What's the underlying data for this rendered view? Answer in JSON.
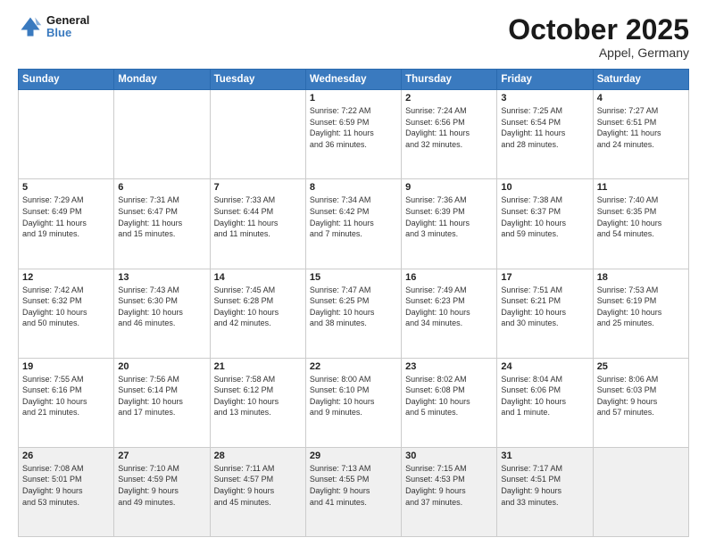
{
  "header": {
    "logo_line1": "General",
    "logo_line2": "Blue",
    "title": "October 2025",
    "subtitle": "Appel, Germany"
  },
  "weekdays": [
    "Sunday",
    "Monday",
    "Tuesday",
    "Wednesday",
    "Thursday",
    "Friday",
    "Saturday"
  ],
  "weeks": [
    [
      {
        "day": "",
        "info": ""
      },
      {
        "day": "",
        "info": ""
      },
      {
        "day": "",
        "info": ""
      },
      {
        "day": "1",
        "info": "Sunrise: 7:22 AM\nSunset: 6:59 PM\nDaylight: 11 hours\nand 36 minutes."
      },
      {
        "day": "2",
        "info": "Sunrise: 7:24 AM\nSunset: 6:56 PM\nDaylight: 11 hours\nand 32 minutes."
      },
      {
        "day": "3",
        "info": "Sunrise: 7:25 AM\nSunset: 6:54 PM\nDaylight: 11 hours\nand 28 minutes."
      },
      {
        "day": "4",
        "info": "Sunrise: 7:27 AM\nSunset: 6:51 PM\nDaylight: 11 hours\nand 24 minutes."
      }
    ],
    [
      {
        "day": "5",
        "info": "Sunrise: 7:29 AM\nSunset: 6:49 PM\nDaylight: 11 hours\nand 19 minutes."
      },
      {
        "day": "6",
        "info": "Sunrise: 7:31 AM\nSunset: 6:47 PM\nDaylight: 11 hours\nand 15 minutes."
      },
      {
        "day": "7",
        "info": "Sunrise: 7:33 AM\nSunset: 6:44 PM\nDaylight: 11 hours\nand 11 minutes."
      },
      {
        "day": "8",
        "info": "Sunrise: 7:34 AM\nSunset: 6:42 PM\nDaylight: 11 hours\nand 7 minutes."
      },
      {
        "day": "9",
        "info": "Sunrise: 7:36 AM\nSunset: 6:39 PM\nDaylight: 11 hours\nand 3 minutes."
      },
      {
        "day": "10",
        "info": "Sunrise: 7:38 AM\nSunset: 6:37 PM\nDaylight: 10 hours\nand 59 minutes."
      },
      {
        "day": "11",
        "info": "Sunrise: 7:40 AM\nSunset: 6:35 PM\nDaylight: 10 hours\nand 54 minutes."
      }
    ],
    [
      {
        "day": "12",
        "info": "Sunrise: 7:42 AM\nSunset: 6:32 PM\nDaylight: 10 hours\nand 50 minutes."
      },
      {
        "day": "13",
        "info": "Sunrise: 7:43 AM\nSunset: 6:30 PM\nDaylight: 10 hours\nand 46 minutes."
      },
      {
        "day": "14",
        "info": "Sunrise: 7:45 AM\nSunset: 6:28 PM\nDaylight: 10 hours\nand 42 minutes."
      },
      {
        "day": "15",
        "info": "Sunrise: 7:47 AM\nSunset: 6:25 PM\nDaylight: 10 hours\nand 38 minutes."
      },
      {
        "day": "16",
        "info": "Sunrise: 7:49 AM\nSunset: 6:23 PM\nDaylight: 10 hours\nand 34 minutes."
      },
      {
        "day": "17",
        "info": "Sunrise: 7:51 AM\nSunset: 6:21 PM\nDaylight: 10 hours\nand 30 minutes."
      },
      {
        "day": "18",
        "info": "Sunrise: 7:53 AM\nSunset: 6:19 PM\nDaylight: 10 hours\nand 25 minutes."
      }
    ],
    [
      {
        "day": "19",
        "info": "Sunrise: 7:55 AM\nSunset: 6:16 PM\nDaylight: 10 hours\nand 21 minutes."
      },
      {
        "day": "20",
        "info": "Sunrise: 7:56 AM\nSunset: 6:14 PM\nDaylight: 10 hours\nand 17 minutes."
      },
      {
        "day": "21",
        "info": "Sunrise: 7:58 AM\nSunset: 6:12 PM\nDaylight: 10 hours\nand 13 minutes."
      },
      {
        "day": "22",
        "info": "Sunrise: 8:00 AM\nSunset: 6:10 PM\nDaylight: 10 hours\nand 9 minutes."
      },
      {
        "day": "23",
        "info": "Sunrise: 8:02 AM\nSunset: 6:08 PM\nDaylight: 10 hours\nand 5 minutes."
      },
      {
        "day": "24",
        "info": "Sunrise: 8:04 AM\nSunset: 6:06 PM\nDaylight: 10 hours\nand 1 minute."
      },
      {
        "day": "25",
        "info": "Sunrise: 8:06 AM\nSunset: 6:03 PM\nDaylight: 9 hours\nand 57 minutes."
      }
    ],
    [
      {
        "day": "26",
        "info": "Sunrise: 7:08 AM\nSunset: 5:01 PM\nDaylight: 9 hours\nand 53 minutes."
      },
      {
        "day": "27",
        "info": "Sunrise: 7:10 AM\nSunset: 4:59 PM\nDaylight: 9 hours\nand 49 minutes."
      },
      {
        "day": "28",
        "info": "Sunrise: 7:11 AM\nSunset: 4:57 PM\nDaylight: 9 hours\nand 45 minutes."
      },
      {
        "day": "29",
        "info": "Sunrise: 7:13 AM\nSunset: 4:55 PM\nDaylight: 9 hours\nand 41 minutes."
      },
      {
        "day": "30",
        "info": "Sunrise: 7:15 AM\nSunset: 4:53 PM\nDaylight: 9 hours\nand 37 minutes."
      },
      {
        "day": "31",
        "info": "Sunrise: 7:17 AM\nSunset: 4:51 PM\nDaylight: 9 hours\nand 33 minutes."
      },
      {
        "day": "",
        "info": ""
      }
    ]
  ]
}
